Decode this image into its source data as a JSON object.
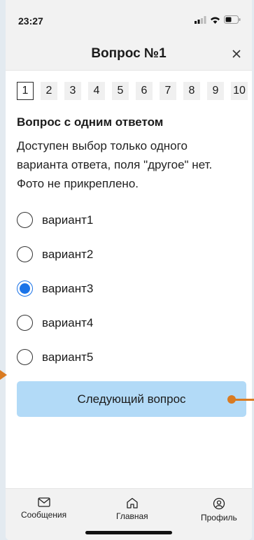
{
  "status_bar": {
    "time": "23:27"
  },
  "header": {
    "title": "Вопрос №1"
  },
  "tabs": [
    "1",
    "2",
    "3",
    "4",
    "5",
    "6",
    "7",
    "8",
    "9",
    "10"
  ],
  "question": {
    "title": "Вопрос с одним ответом",
    "description": "Доступен выбор только одного варианта ответа, поля \"другое\" нет. Фото не прикреплено.",
    "options": [
      {
        "label": "вариант1",
        "selected": false
      },
      {
        "label": "вариант2",
        "selected": false
      },
      {
        "label": "вариант3",
        "selected": true
      },
      {
        "label": "вариант4",
        "selected": false
      },
      {
        "label": "вариант5",
        "selected": false
      }
    ]
  },
  "next_button": {
    "label": "Следующий вопрос"
  },
  "tabbar": {
    "messages": "Сообщения",
    "home": "Главная",
    "profile": "Профиль"
  },
  "colors": {
    "accent": "#1a73e8",
    "button": "#b2daf7",
    "annotation": "#d97b22"
  }
}
